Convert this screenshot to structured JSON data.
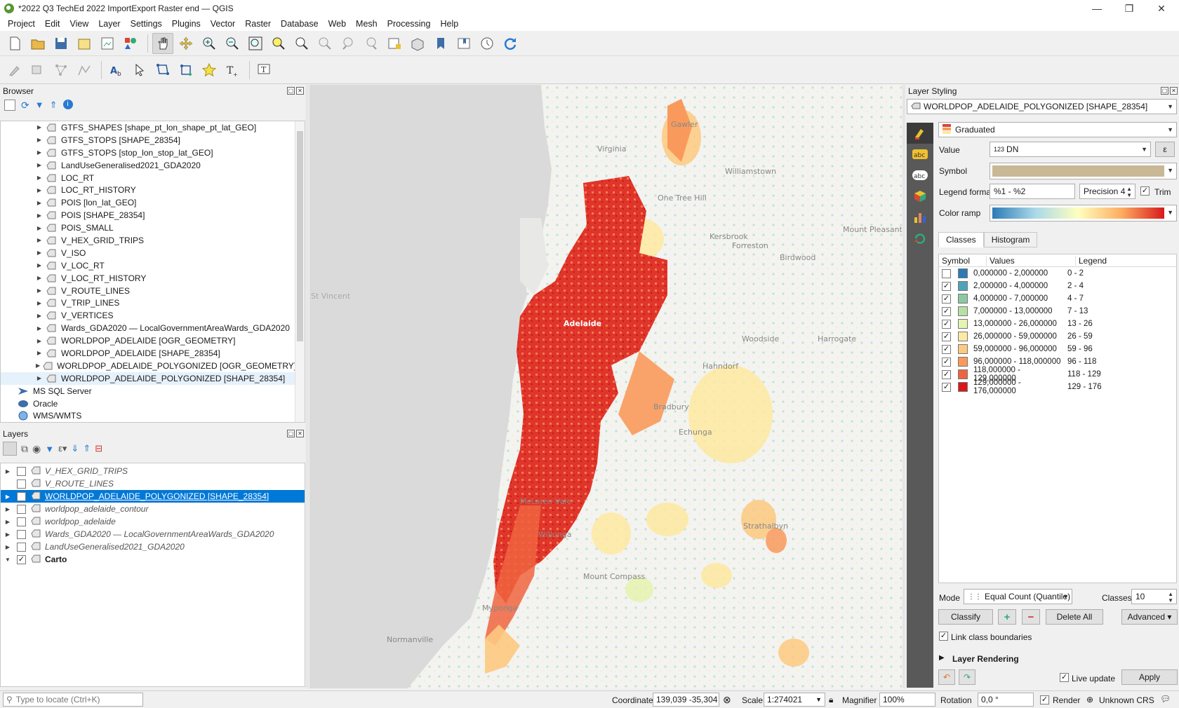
{
  "window": {
    "title": "*2022 Q3 TechEd 2022 ImportExport Raster end — QGIS"
  },
  "menu": [
    "Project",
    "Edit",
    "View",
    "Layer",
    "Settings",
    "Plugins",
    "Vector",
    "Raster",
    "Database",
    "Web",
    "Mesh",
    "Processing",
    "Help"
  ],
  "browser": {
    "title": "Browser",
    "items": [
      "GTFS_SHAPES [shape_pt_lon_shape_pt_lat_GEO]",
      "GTFS_STOPS [SHAPE_28354]",
      "GTFS_STOPS [stop_lon_stop_lat_GEO]",
      "LandUseGeneralised2021_GDA2020",
      "LOC_RT",
      "LOC_RT_HISTORY",
      "POIS [lon_lat_GEO]",
      "POIS [SHAPE_28354]",
      "POIS_SMALL",
      "V_HEX_GRID_TRIPS",
      "V_ISO",
      "V_LOC_RT",
      "V_LOC_RT_HISTORY",
      "V_ROUTE_LINES",
      "V_TRIP_LINES",
      "V_VERTICES",
      "Wards_GDA2020 — LocalGovernmentAreaWards_GDA2020",
      "WORLDPOP_ADELAIDE [OGR_GEOMETRY]",
      "WORLDPOP_ADELAIDE [SHAPE_28354]",
      "WORLDPOP_ADELAIDE_POLYGONIZED [OGR_GEOMETRY]",
      "WORLDPOP_ADELAIDE_POLYGONIZED [SHAPE_28354]"
    ],
    "roots": [
      "MS SQL Server",
      "Oracle",
      "WMS/WMTS"
    ]
  },
  "layers": {
    "title": "Layers",
    "items": [
      {
        "name": "V_HEX_GRID_TRIPS",
        "checked": false,
        "style": "italic"
      },
      {
        "name": "V_ROUTE_LINES",
        "checked": false,
        "style": "italic"
      },
      {
        "name": "WORLDPOP_ADELAIDE_POLYGONIZED [SHAPE_28354]",
        "checked": true,
        "style": "selected"
      },
      {
        "name": "worldpop_adelaide_contour",
        "checked": false,
        "style": "italic"
      },
      {
        "name": "worldpop_adelaide",
        "checked": false,
        "style": "italic"
      },
      {
        "name": "Wards_GDA2020 — LocalGovernmentAreaWards_GDA2020",
        "checked": false,
        "style": "italic"
      },
      {
        "name": "LandUseGeneralised2021_GDA2020",
        "checked": false,
        "style": "italic"
      },
      {
        "name": "Carto",
        "checked": true,
        "style": "bold"
      }
    ]
  },
  "map": {
    "labels": [
      "Gawler",
      "Virginia",
      "Williamstown",
      "One Tree Hill",
      "Kersbrook",
      "Forreston",
      "Birdwood",
      "Mount Pleasant",
      "Woodside",
      "Hahndorf",
      "Harrogate",
      "Bradbury",
      "Echunga",
      "Strathalbyn",
      "McLaren Vale",
      "Willunga",
      "Mount Compass",
      "Myponga",
      "Normanville",
      "St Vincent",
      "Adelaide"
    ]
  },
  "styling": {
    "title": "Layer Styling",
    "layer": "WORLDPOP_ADELAIDE_POLYGONIZED [SHAPE_28354]",
    "renderer": "Graduated",
    "value_label": "Value",
    "value": "DN",
    "value_type": "123",
    "symbol_label": "Symbol",
    "symbol_color": "#c8b896",
    "legend_format_label": "Legend format",
    "legend_format": "%1 - %2",
    "precision": "Precision 4",
    "trim": "Trim",
    "color_ramp_label": "Color ramp",
    "tabs": [
      "Classes",
      "Histogram"
    ],
    "columns": [
      "Symbol",
      "Values",
      "Legend"
    ],
    "classes": [
      {
        "checked": false,
        "color": "#2c7bb6",
        "values": "0,000000 - 2,000000",
        "legend": "0 - 2"
      },
      {
        "checked": true,
        "color": "#4fa3b8",
        "values": "2,000000 - 4,000000",
        "legend": "2 - 4"
      },
      {
        "checked": true,
        "color": "#8cc9a2",
        "values": "4,000000 - 7,000000",
        "legend": "4 - 7"
      },
      {
        "checked": true,
        "color": "#b8e0a6",
        "values": "7,000000 - 13,000000",
        "legend": "7 - 13"
      },
      {
        "checked": true,
        "color": "#e5f4b0",
        "values": "13,000000 - 26,000000",
        "legend": "13 - 26"
      },
      {
        "checked": true,
        "color": "#fee9a4",
        "values": "26,000000 - 59,000000",
        "legend": "26 - 59"
      },
      {
        "checked": true,
        "color": "#fdc980",
        "values": "59,000000 - 96,000000",
        "legend": "59 - 96"
      },
      {
        "checked": true,
        "color": "#f99a5c",
        "values": "96,000000 - 118,000000",
        "legend": "96 - 118"
      },
      {
        "checked": true,
        "color": "#ef6440",
        "values": "118,000000 - 129,000000",
        "legend": "118 - 129"
      },
      {
        "checked": true,
        "color": "#d7191c",
        "values": "129,000000 - 176,000000",
        "legend": "129 - 176"
      }
    ],
    "mode_label": "Mode",
    "mode": "Equal Count (Quantile)",
    "classes_label": "Classes",
    "classes_count": "10",
    "classify": "Classify",
    "delete_all": "Delete All",
    "advanced": "Advanced",
    "link_boundaries": "Link class boundaries",
    "layer_rendering": "Layer Rendering",
    "live_update": "Live update",
    "apply": "Apply"
  },
  "status": {
    "locate_placeholder": "Type to locate (Ctrl+K)",
    "coordinate_label": "Coordinate",
    "coordinate": "139,039 -35,304",
    "scale_label": "Scale",
    "scale": "1:274021",
    "magnifier_label": "Magnifier",
    "magnifier": "100%",
    "rotation_label": "Rotation",
    "rotation": "0,0 °",
    "render": "Render",
    "crs": "Unknown CRS"
  }
}
